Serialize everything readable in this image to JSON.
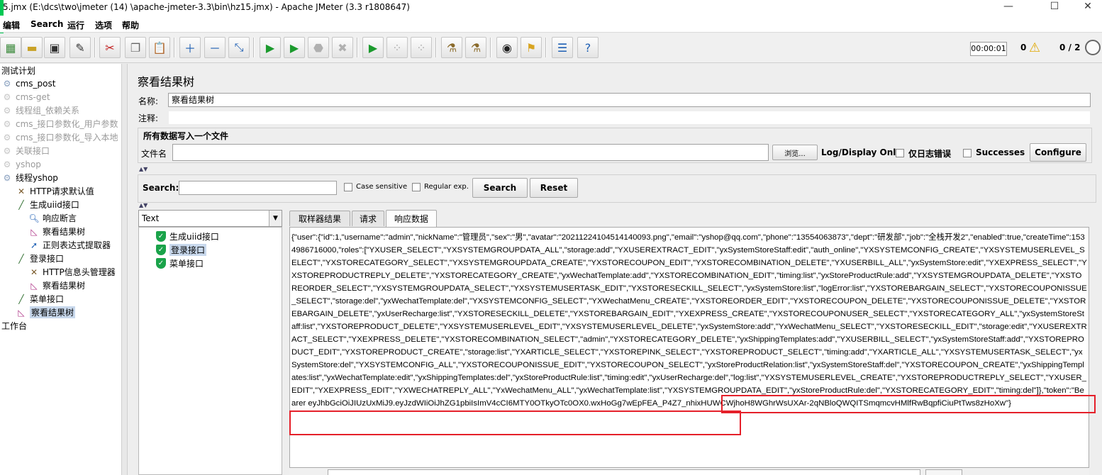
{
  "window": {
    "title": "5.jmx (E:\\dcs\\two\\jmeter  (14)  \\apache-jmeter-3.3\\bin\\hz15.jmx) - Apache JMeter (3.3 r1808647)",
    "minimize": "—",
    "maximize": "☐",
    "close": "✕"
  },
  "menu": {
    "items": [
      "编辑",
      "Search",
      "运行",
      "选项",
      "帮助"
    ]
  },
  "toolbar": {
    "timer": "00:00:01",
    "error_count": "0",
    "threads": "0 / 2"
  },
  "tree": {
    "items": [
      {
        "label": "测试计划",
        "icon": "none"
      },
      {
        "label": "cms_post",
        "icon": "gear-icon"
      },
      {
        "label": "cms-get",
        "icon": "gear-icon"
      },
      {
        "label": "线程组_依赖关系",
        "icon": "gear-icon"
      },
      {
        "label": "cms_接口参数化_用户参数",
        "icon": "gear-icon"
      },
      {
        "label": "cms_接口参数化_导入本地",
        "icon": "gear-icon"
      },
      {
        "label": "关联接口",
        "icon": "gear-icon"
      },
      {
        "label": "yshop",
        "icon": "gear-icon"
      },
      {
        "label": "线程yshop",
        "icon": "gear-icon"
      },
      {
        "label": "HTTP请求默认值",
        "icon": "wrench-icon"
      },
      {
        "label": "生成uiid接口",
        "icon": "pipette-icon"
      },
      {
        "label": "响应断言",
        "icon": "magnifier-icon"
      },
      {
        "label": "察看结果树",
        "icon": "chart-icon"
      },
      {
        "label": "正则表达式提取器",
        "icon": "extractor-icon"
      },
      {
        "label": "登录接口",
        "icon": "pipette-icon"
      },
      {
        "label": "HTTP信息头管理器",
        "icon": "wrench-icon"
      },
      {
        "label": "察看结果树",
        "icon": "chart-icon"
      },
      {
        "label": "菜单接口",
        "icon": "pipette-icon"
      },
      {
        "label": "察看结果树",
        "icon": "chart-icon"
      },
      {
        "label": "工作台",
        "icon": "none"
      }
    ]
  },
  "panel": {
    "title": "察看结果树",
    "name_label": "名称:",
    "name_value": "察看结果树",
    "comment_label": "注释:",
    "file_section_title": "所有数据写入一个文件",
    "filename_label": "文件名",
    "browse_button": "浏览...",
    "log_display_label": "Log/Display Only:",
    "errors_only_label": "仅日志错误",
    "successes_label": "Successes",
    "configure_button": "Configure"
  },
  "search": {
    "label": "Search:",
    "case_sensitive": "Case sensitive",
    "regular_exp": "Regular exp.",
    "search_button": "Search",
    "reset_button": "Reset"
  },
  "results": {
    "renderer": "Text",
    "samples": [
      "生成uiid接口",
      "登录接口",
      "菜单接口"
    ],
    "tabs": [
      "取样器结果",
      "请求",
      "响应数据"
    ],
    "active_tab": "响应数据",
    "response_text": "{\"user\":{\"id\":1,\"username\":\"admin\",\"nickName\":\"管理员\",\"sex\":\"男\",\"avatar\":\"20211224104514140093.png\",\"email\":\"yshop@qq.com\",\"phone\":\"13554063873\",\"dept\":\"研发部\",\"job\":\"全栈开发2\",\"enabled\":true,\"createTime\":1534986716000,\"roles\":[\"YXUSER_SELECT\",\"YXSYSTEMGROUPDATA_ALL\",\"storage:add\",\"YXUSEREXTRACT_EDIT\",\"yxSystemStoreStaff:edit\",\"auth_online\",\"YXSYSTEMCONFIG_CREATE\",\"YXSYSTEMUSERLEVEL_SELECT\",\"YXSTORECATEGORY_SELECT\",\"YXSYSTEMGROUPDATA_CREATE\",\"YXSTORECOUPON_EDIT\",\"YXSTORECOMBINATION_DELETE\",\"YXUSERBILL_ALL\",\"yxSystemStore:edit\",\"YXEXPRESS_SELECT\",\"YXSTOREPRODUCTREPLY_DELETE\",\"YXSTORECATEGORY_CREATE\",\"yxWechatTemplate:add\",\"YXSTORECOMBINATION_EDIT\",\"timing:list\",\"yxStoreProductRule:add\",\"YXSYSTEMGROUPDATA_DELETE\",\"YXSTOREORDER_SELECT\",\"YXSYSTEMGROUPDATA_SELECT\",\"YXSYSTEMUSERTASK_EDIT\",\"YXSTORESECKILL_SELECT\",\"yxSystemStore:list\",\"logError:list\",\"YXSTOREBARGAIN_SELECT\",\"YXSTORECOUPONISSUE_SELECT\",\"storage:del\",\"yxWechatTemplate:del\",\"YXSYSTEMCONFIG_SELECT\",\"YXWechatMenu_CREATE\",\"YXSTOREORDER_EDIT\",\"YXSTORECOUPON_DELETE\",\"YXSTORECOUPONISSUE_DELETE\",\"YXSTOREBARGAIN_DELETE\",\"yxUserRecharge:list\",\"YXSTORESECKILL_DELETE\",\"YXSTOREBARGAIN_EDIT\",\"YXEXPRESS_CREATE\",\"YXSTORECOUPONUSER_SELECT\",\"YXSTORECATEGORY_ALL\",\"yxSystemStoreStaff:list\",\"YXSTOREPRODUCT_DELETE\",\"YXSYSTEMUSERLEVEL_EDIT\",\"YXSYSTEMUSERLEVEL_DELETE\",\"yxSystemStore:add\",\"YxWechatMenu_SELECT\",\"YXSTORESECKILL_EDIT\",\"storage:edit\",\"YXUSEREXTRACT_SELECT\",\"YXEXPRESS_DELETE\",\"YXSTORECOMBINATION_SELECT\",\"admin\",\"YXSTORECATEGORY_DELETE\",\"yxShippingTemplates:add\",\"YXUSERBILL_SELECT\",\"yxSystemStoreStaff:add\",\"YXSTOREPRODUCT_EDIT\",\"YXSTOREPRODUCT_CREATE\",\"storage:list\",\"YXARTICLE_SELECT\",\"YXSTOREPINK_SELECT\",\"YXSTOREPRODUCT_SELECT\",\"timing:add\",\"YXARTICLE_ALL\",\"YXSYSTEMUSERTASK_SELECT\",\"yxSystemStore:del\",\"YXSYSTEMCONFIG_ALL\",\"YXSTORECOUPONISSUE_EDIT\",\"YXSTORECOUPON_SELECT\",\"yxStoreProductRelation:list\",\"yxSystemStoreStaff:del\",\"YXSTORECOUPON_CREATE\",\"yxShippingTemplates:list\",\"yxWechatTemplate:edit\",\"yxShippingTemplates:del\",\"yxStoreProductRule:list\",\"timing:edit\",\"yxUserRecharge:del\",\"log:list\",\"YXSYSTEMUSERLEVEL_CREATE\",\"YXSTOREPRODUCTREPLY_SELECT\",\"YXUSER_EDIT\",\"YXEXPRESS_EDIT\",\"YXWECHATREPLY_ALL\",\"YxWechatMenu_ALL\",\"yxWechatTemplate:list\",\"YXSYSTEMGROUPDATA_EDIT\",\"yxStoreProductRule:del\",\"YXSTORECATEGORY_EDIT\",\"timing:del\"]},\"token\":\"Bearer eyJhbGciOiJIUzUxMiJ9.eyJzdWIiOiJhZG1pbiIsImV4cCI6MTY0OTkyOTc0OX0.wxHoGg7wEpFEA_P4Z7_nhixHUWCWjhoH8WGhrWsUXAr-2qNBloQWQITSmqmcvHMlfRwBqpfiCiuPtTws8zHoXw\"}"
  },
  "colors": {
    "highlight": "#e5202a",
    "selection": "#c8d8ec",
    "success_icon": "#1aa34a"
  }
}
